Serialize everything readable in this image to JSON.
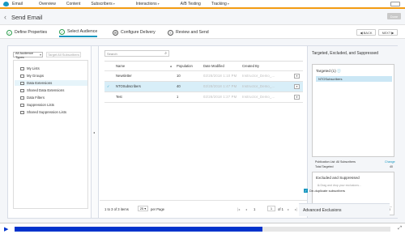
{
  "topnav": {
    "app": "Email",
    "items": [
      {
        "label": "Overview",
        "caret": false
      },
      {
        "label": "Content",
        "caret": false
      },
      {
        "label": "Subscribers",
        "caret": true
      },
      {
        "label": "Interactions",
        "caret": true
      },
      {
        "label": "A/B Testing",
        "caret": false
      },
      {
        "label": "Tracking",
        "caret": true
      }
    ]
  },
  "header": {
    "title": "Send Email",
    "done_label": "Done",
    "back_label": "◀ BACK",
    "next_label": "NEXT ▶"
  },
  "steps": [
    {
      "label": "Define Properties"
    },
    {
      "label": "Select Audience"
    },
    {
      "label": "Configure Delivery"
    },
    {
      "label": "Review and Send"
    }
  ],
  "tree": {
    "select_value": "All Audience Types",
    "target_placeholder": "Target All Subscribers",
    "items": [
      "My Lists",
      "My Groups",
      "Data Extensions",
      "Shared Data Extensions",
      "Data Filters",
      "Suppression Lists",
      "Shared Suppression Lists"
    ]
  },
  "table": {
    "search_placeholder": "Search",
    "columns": [
      "Name",
      "Population",
      "Date Modified",
      "Created By"
    ],
    "rows": [
      {
        "name": "Newsletter",
        "population": "10",
        "date": "02/28/2018 1:10 PM",
        "created": "Instructor_Demo_..."
      },
      {
        "name": "NTOSubscribers",
        "population": "40",
        "date": "02/28/2018 1:47 PM",
        "created": "Instructor_Demo_..."
      },
      {
        "name": "Test",
        "population": "1",
        "date": "02/28/2018 1:27 PM",
        "created": "Instructor_Demo_..."
      }
    ],
    "pager": {
      "range": "1 to 3 of 3 items",
      "per_page": "25",
      "per_page_label": "per Page",
      "page_label": "Page",
      "page": "1",
      "of": "of 1"
    }
  },
  "right": {
    "title": "Targeted, Excluded, and Suppressed",
    "targeted_label": "Targeted (1)",
    "targeted_item": "NTOSubscribers",
    "pub_list_label": "Publication List:",
    "pub_list_value": "All Subscribers",
    "change_label": "Change",
    "total_targeted_label": "Total Targeted",
    "total_targeted_value": "40",
    "excluded_label": "Excluded and Suppressed",
    "drop_hint": "Drag and drop your exclusions...",
    "total_excluded_label": "Total Excluded",
    "total_excluded_value": "0",
    "dedup_label": "De-duplicate subscribers",
    "advanced_label": "Advanced Exclusions"
  },
  "player": {
    "progress": 0.66
  },
  "colors": {
    "accent": "#1797c0",
    "orange": "#f39c12",
    "progress": "#0033cc"
  }
}
